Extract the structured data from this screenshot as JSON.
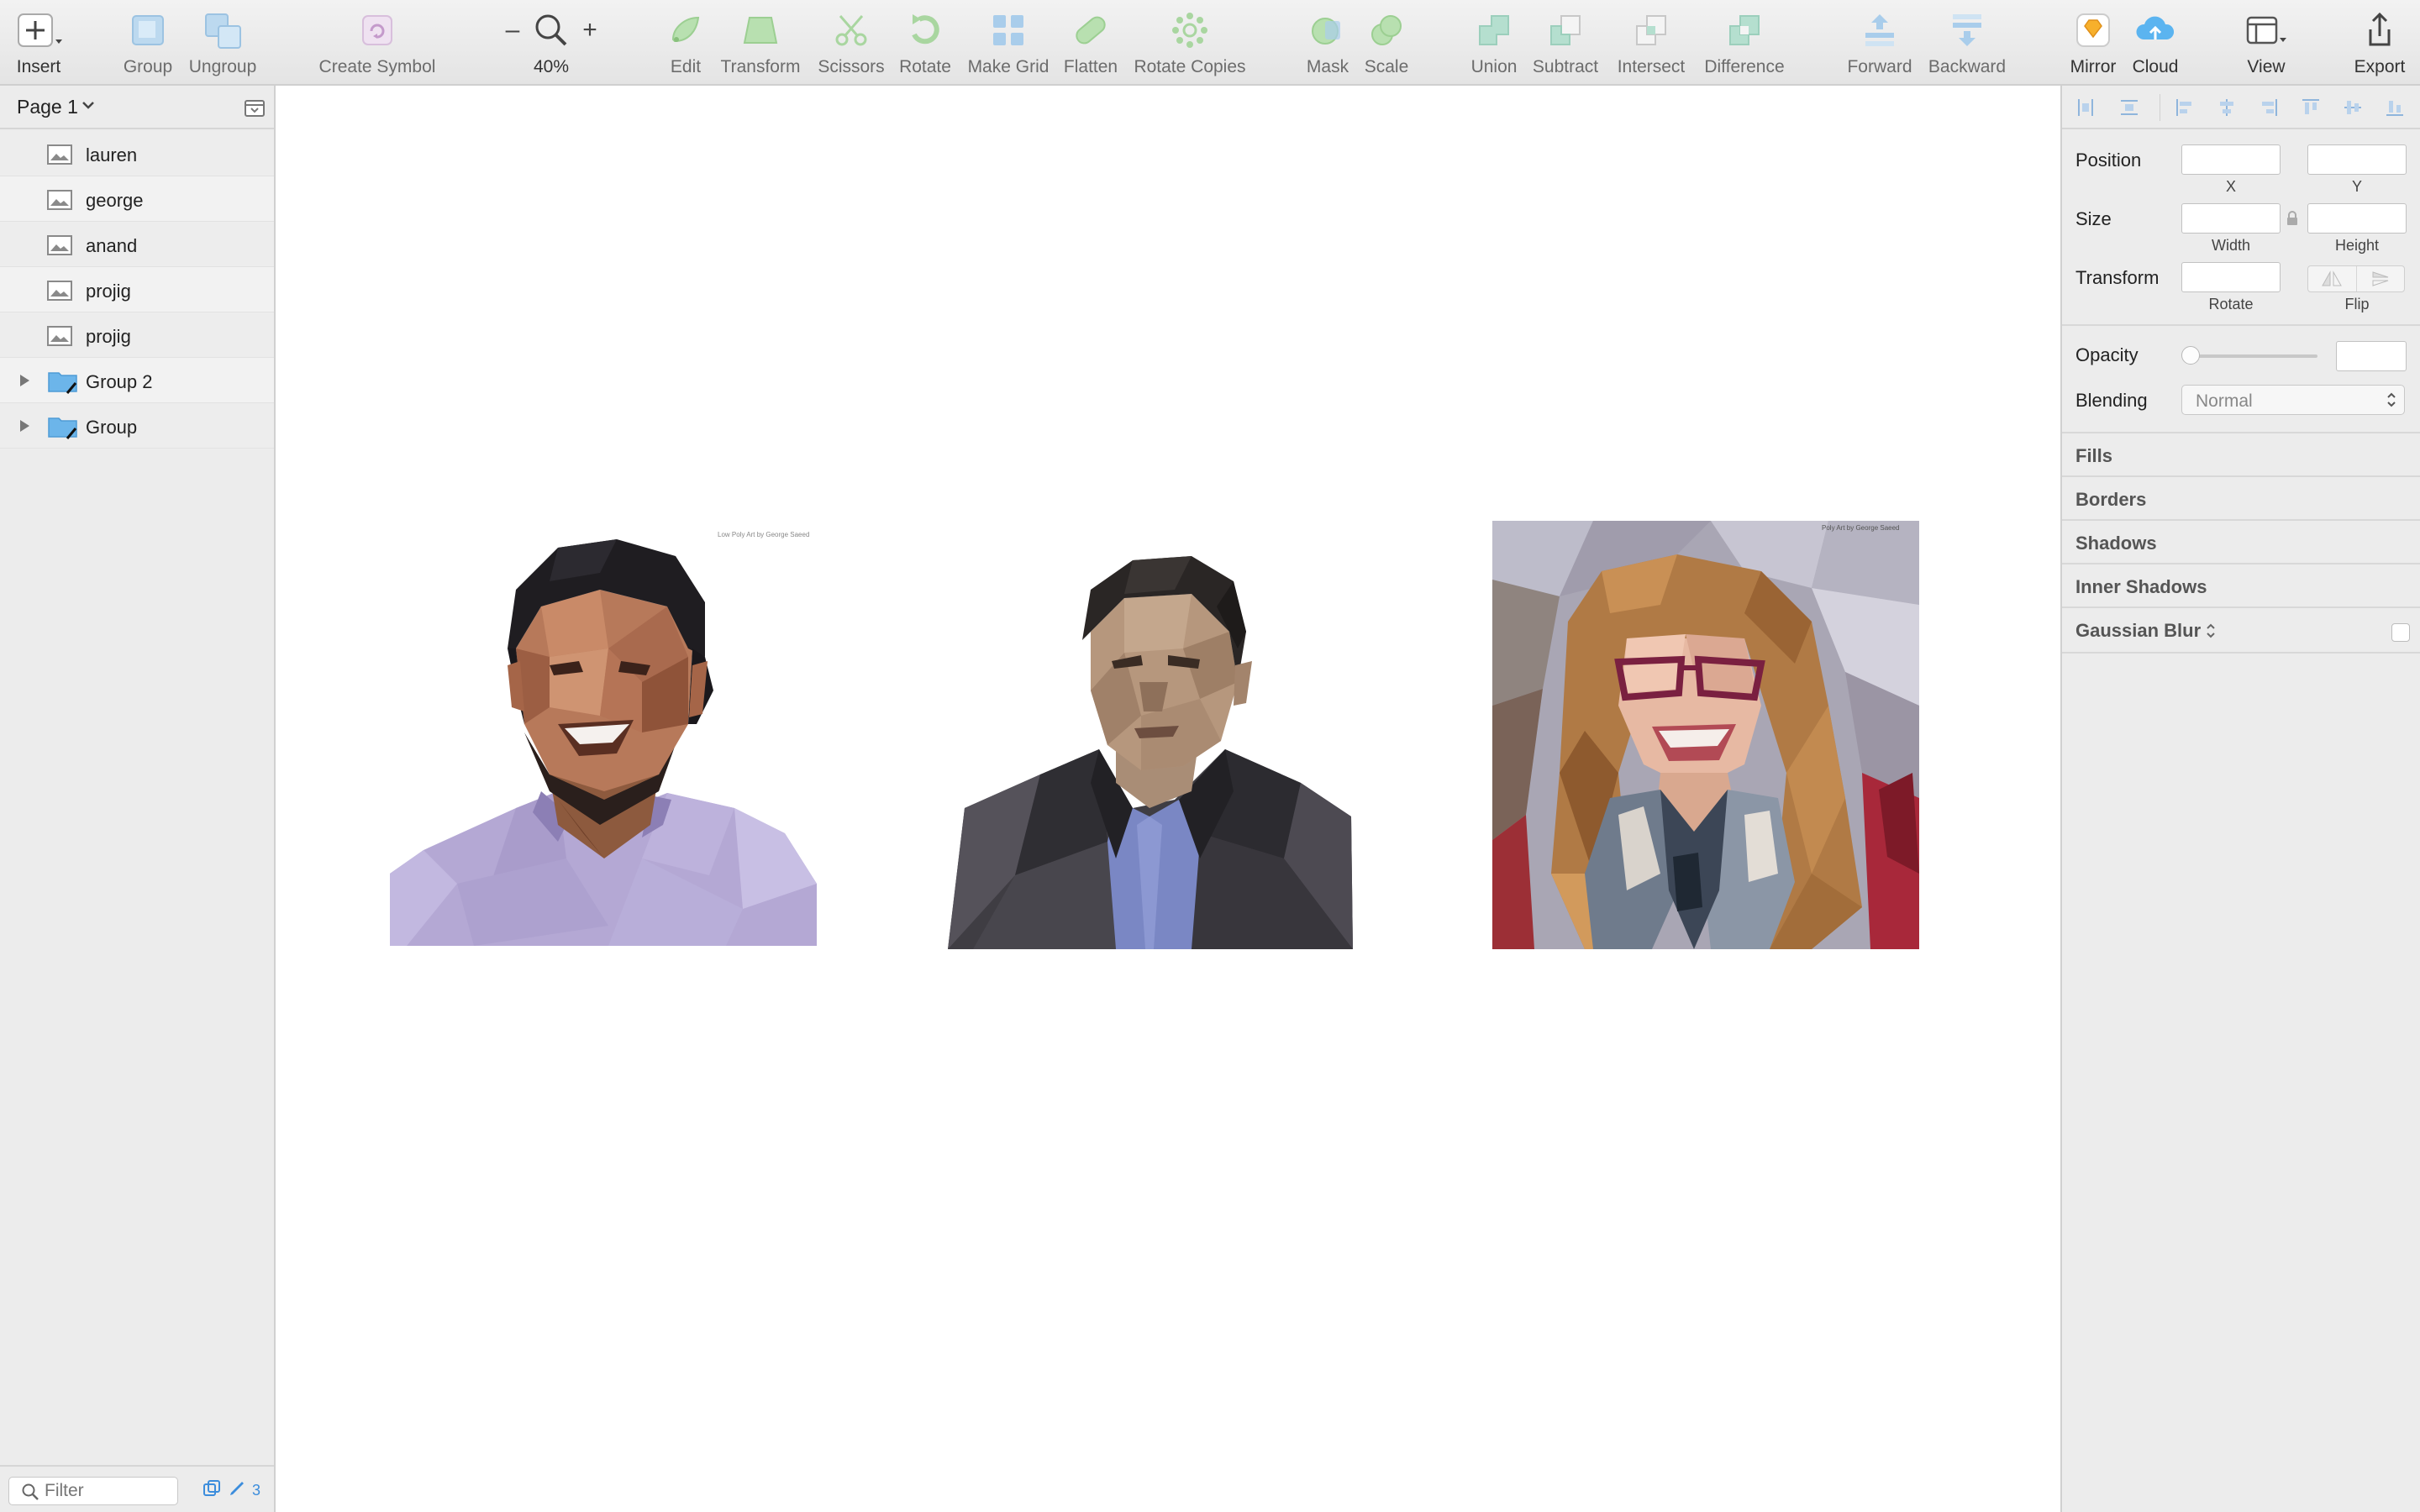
{
  "toolbar": {
    "insert": "Insert",
    "group": "Group",
    "ungroup": "Ungroup",
    "create_symbol": "Create Symbol",
    "zoom_minus": "–",
    "zoom_plus": "+",
    "zoom_level": "40%",
    "edit": "Edit",
    "transform": "Transform",
    "scissors": "Scissors",
    "rotate": "Rotate",
    "make_grid": "Make Grid",
    "flatten": "Flatten",
    "rotate_copies": "Rotate Copies",
    "mask": "Mask",
    "scale": "Scale",
    "union": "Union",
    "subtract": "Subtract",
    "intersect": "Intersect",
    "difference": "Difference",
    "forward": "Forward",
    "backward": "Backward",
    "mirror": "Mirror",
    "cloud": "Cloud",
    "view": "View",
    "export": "Export"
  },
  "sidebar": {
    "page_name": "Page 1",
    "layers": [
      {
        "name": "lauren",
        "kind": "image"
      },
      {
        "name": "george",
        "kind": "image"
      },
      {
        "name": "anand",
        "kind": "image"
      },
      {
        "name": "projig",
        "kind": "image"
      },
      {
        "name": "projig",
        "kind": "image"
      },
      {
        "name": "Group 2",
        "kind": "group"
      },
      {
        "name": "Group",
        "kind": "group"
      }
    ],
    "filter_placeholder": "Filter",
    "edited_count": "3"
  },
  "canvas": {
    "artboards": [
      {
        "caption": "Low Poly Art by George Saeed"
      },
      {
        "caption": ""
      },
      {
        "caption": "Poly Art by George Saeed"
      }
    ]
  },
  "inspector": {
    "position_label": "Position",
    "x_label": "X",
    "y_label": "Y",
    "size_label": "Size",
    "width_label": "Width",
    "height_label": "Height",
    "transform_label": "Transform",
    "rotate_label": "Rotate",
    "flip_label": "Flip",
    "opacity_label": "Opacity",
    "blending_label": "Blending",
    "blending_value": "Normal",
    "fills": "Fills",
    "borders": "Borders",
    "shadows": "Shadows",
    "inner_shadows": "Inner Shadows",
    "gaussian_blur": "Gaussian Blur"
  },
  "colors": {
    "accent": "#3c8ddc",
    "toolbar_bg": "#ececec",
    "sidebar_bg": "#ececec"
  }
}
